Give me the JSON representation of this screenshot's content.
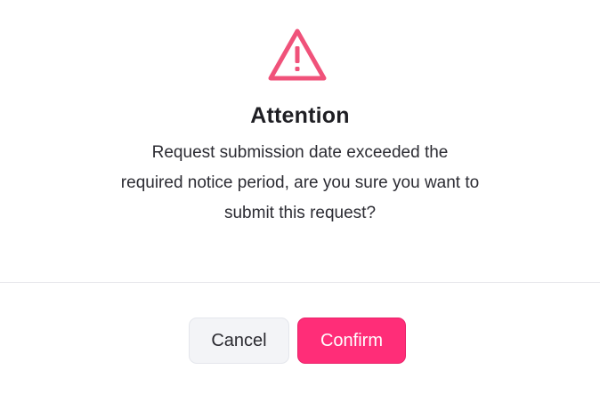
{
  "dialog": {
    "icon": "warning-triangle-icon",
    "title": "Attention",
    "message_lines": [
      "Request submission date exceeded the",
      "required notice period, are you sure you want to",
      "submit this request?"
    ],
    "cancel_label": "Cancel",
    "confirm_label": "Confirm"
  },
  "colors": {
    "accent": "#ff2d78",
    "icon": "#f0527a"
  }
}
